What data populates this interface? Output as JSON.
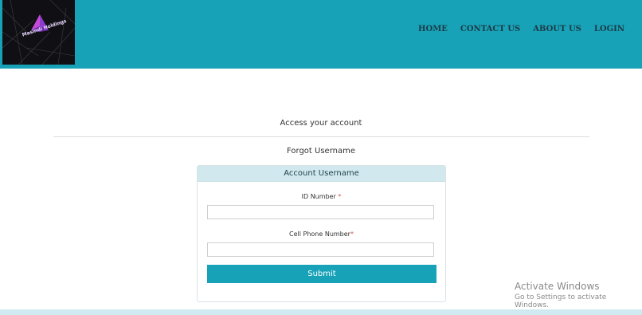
{
  "header": {
    "logo_text": "Masindi Holdings",
    "nav": [
      "HOME",
      "CONTACT US",
      "ABOUT US",
      "LOGIN"
    ]
  },
  "page": {
    "heading": "Access your account",
    "subheading": "Forgot Username"
  },
  "card": {
    "title": "Account Username",
    "id_label": "ID Number",
    "id_required": "*",
    "phone_label": "Cell Phone Number",
    "phone_required": "*",
    "id_value": "",
    "phone_value": "",
    "submit_label": "Submit"
  },
  "watermark": {
    "title": "Activate Windows",
    "subtitle": "Go to Settings to activate Windows."
  },
  "colors": {
    "header_bg": "#17a2b8",
    "accent": "#17a2b8",
    "card_header_bg": "#d1e9ee"
  }
}
